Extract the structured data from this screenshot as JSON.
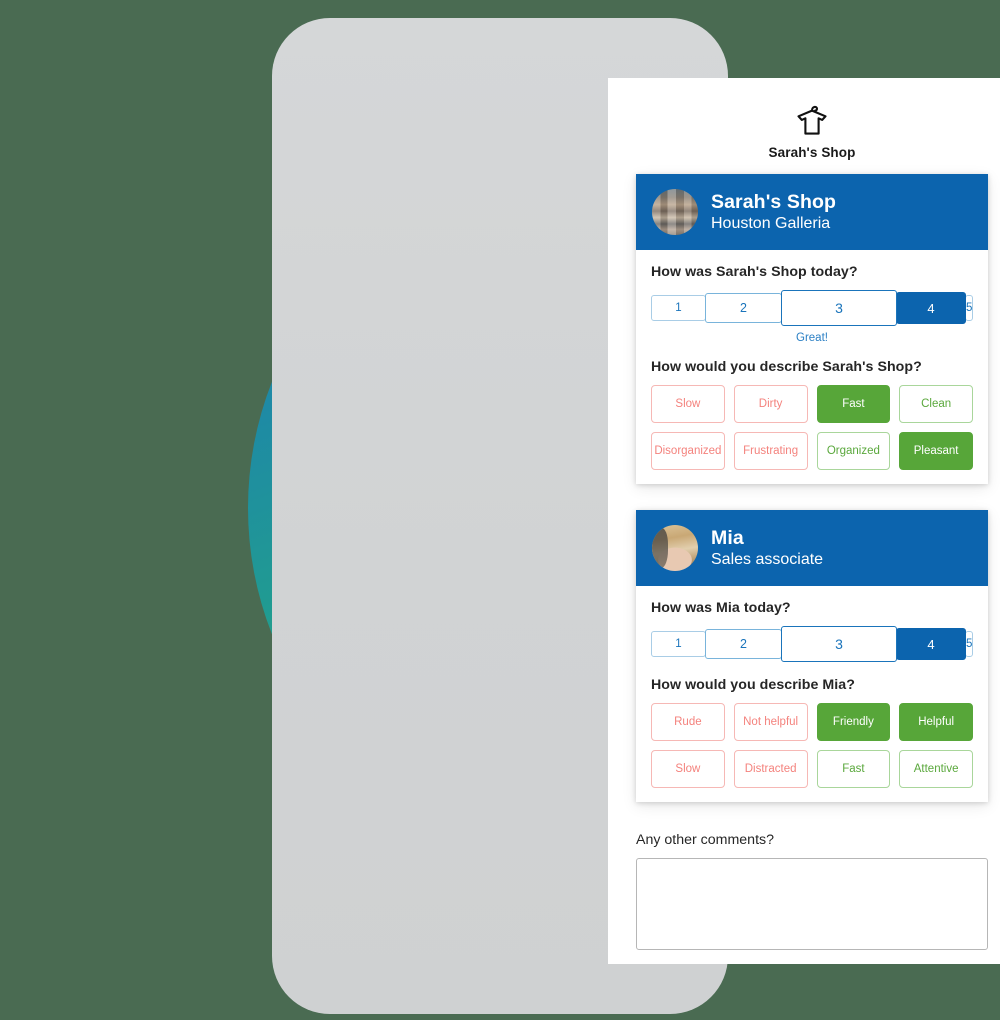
{
  "brand": {
    "name": "Sarah's Shop",
    "logo_icon": "tshirt-hanger-icon"
  },
  "colors": {
    "accent_blue": "#0C64AE",
    "link_blue": "#1A74BB",
    "positive_green": "#57A639",
    "negative_red": "#F4827D",
    "phone_frame": "#D3D5D6",
    "screen_bg": "#FFFFFF"
  },
  "cards": [
    {
      "avatar_icon": "store-photo-avatar",
      "title": "Sarah's Shop",
      "subtitle": "Houston Galleria",
      "rating_question": "How was Sarah's Shop today?",
      "scale": {
        "options": [
          "1",
          "2",
          "3",
          "4",
          "5"
        ],
        "selected": "4",
        "note": "Great!"
      },
      "tags_question": "How would you describe Sarah's Shop?",
      "tags": [
        {
          "label": "Slow",
          "tone": "negative",
          "selected": false
        },
        {
          "label": "Dirty",
          "tone": "negative",
          "selected": false
        },
        {
          "label": "Fast",
          "tone": "positive",
          "selected": true
        },
        {
          "label": "Clean",
          "tone": "positive",
          "selected": false
        },
        {
          "label": "Disorganized",
          "tone": "negative",
          "selected": false
        },
        {
          "label": "Frustrating",
          "tone": "negative",
          "selected": false
        },
        {
          "label": "Organized",
          "tone": "positive",
          "selected": false
        },
        {
          "label": "Pleasant",
          "tone": "positive",
          "selected": true
        }
      ]
    },
    {
      "avatar_icon": "person-photo-avatar",
      "title": "Mia",
      "subtitle": "Sales associate",
      "rating_question": "How was Mia today?",
      "scale": {
        "options": [
          "1",
          "2",
          "3",
          "4",
          "5"
        ],
        "selected": "4",
        "note": ""
      },
      "tags_question": "How would you describe Mia?",
      "tags": [
        {
          "label": "Rude",
          "tone": "negative",
          "selected": false
        },
        {
          "label": "Not helpful",
          "tone": "negative",
          "selected": false
        },
        {
          "label": "Friendly",
          "tone": "positive",
          "selected": true
        },
        {
          "label": "Helpful",
          "tone": "positive",
          "selected": true
        },
        {
          "label": "Slow",
          "tone": "negative",
          "selected": false
        },
        {
          "label": "Distracted",
          "tone": "negative",
          "selected": false
        },
        {
          "label": "Fast",
          "tone": "positive",
          "selected": false
        },
        {
          "label": "Attentive",
          "tone": "positive",
          "selected": false
        }
      ]
    }
  ],
  "comments": {
    "label": "Any other comments?",
    "value": "",
    "placeholder": ""
  }
}
